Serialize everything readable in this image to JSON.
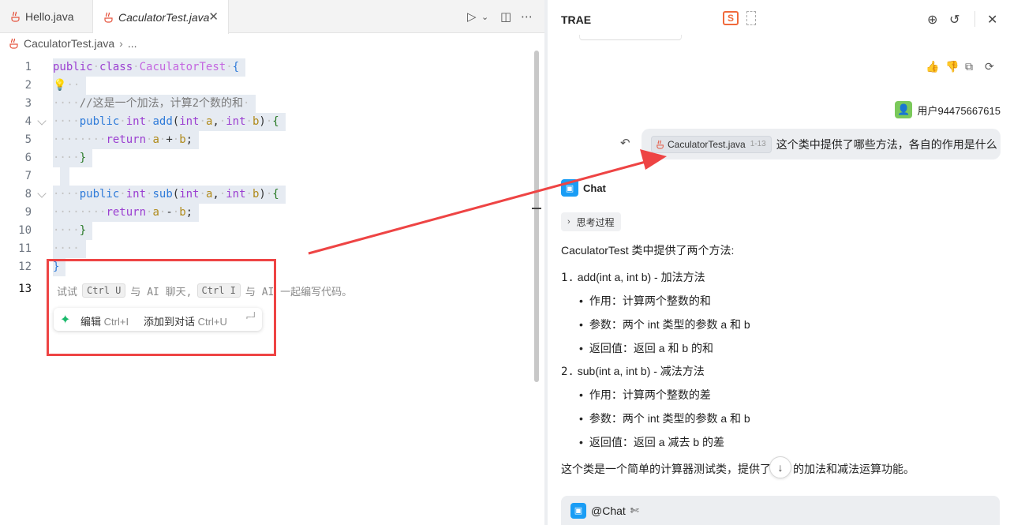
{
  "editor": {
    "tabs": [
      {
        "label": "Hello.java"
      },
      {
        "label": "CaculatorTest.java"
      }
    ],
    "breadcrumb": {
      "file": "CaculatorTest.java",
      "more": "..."
    },
    "line_numbers": [
      "1",
      "2",
      "3",
      "4",
      "5",
      "6",
      "7",
      "8",
      "9",
      "10",
      "11",
      "12",
      "13"
    ],
    "code": {
      "l1": {
        "kw1": "public",
        "kw2": "class",
        "cls": "CaculatorTest",
        "br": "{"
      },
      "l3": {
        "comment": "//这是一个加法，计算2个数的和"
      },
      "l4": {
        "kw": "public",
        "type": "int",
        "fn": "add",
        "open": "(",
        "t1": "int",
        "a": "a",
        "comma": ",",
        "t2": "int",
        "b": "b",
        "close": ")",
        "br": "{"
      },
      "l5": {
        "kw": "return",
        "a": "a",
        "op": "+",
        "b": "b",
        "semi": ";"
      },
      "l6": {
        "br": "}"
      },
      "l8": {
        "kw": "public",
        "type": "int",
        "fn": "sub",
        "open": "(",
        "t1": "int",
        "a": "a",
        "comma": ",",
        "t2": "int",
        "b": "b",
        "close": ")",
        "br": "{"
      },
      "l9": {
        "kw": "return",
        "a": "a",
        "op": "-",
        "b": "b",
        "semi": ";"
      },
      "l10": {
        "br": "}"
      },
      "l12": {
        "br": "}"
      }
    },
    "hint": {
      "pre": "试试",
      "key1": "Ctrl U",
      "mid1": "与 AI 聊天,",
      "key2": "Ctrl I",
      "mid2": "与 AI 一起编写代码。"
    },
    "float_bar": {
      "edit_label": "编辑",
      "edit_key": "Ctrl+I",
      "add_label": "添加到对话",
      "add_key": "Ctrl+U"
    }
  },
  "chat": {
    "title": "TRAE",
    "brand_glyph": "S",
    "user": {
      "name": "用户94475667615"
    },
    "user_message": {
      "file_chip": "CaculatorTest.java",
      "range": "1-13",
      "text": "这个类中提供了哪些方法，各自的作用是什么"
    },
    "bot": {
      "name": "Chat"
    },
    "thinking_label": "思考过程",
    "answer": {
      "intro": "CaculatorTest 类中提供了两个方法:",
      "m1": {
        "num": "1.",
        "title": "add(int a, int b) - 加法方法",
        "bullets": [
          "作用：计算两个整数的和",
          "参数：两个 int 类型的参数 a 和 b",
          "返回值：返回 a 和 b 的和"
        ]
      },
      "m2": {
        "num": "2.",
        "title": "sub(int a, int b) - 减法方法",
        "bullets": [
          "作用：计算两个整数的差",
          "参数：两个 int 类型的参数 a 和 b",
          "返回值：返回 a 减去 b 的差"
        ]
      },
      "summary_before": "这个类是一个简单的计算器测试类，提供了",
      "summary_after": "的加法和减法运算功能。"
    },
    "input": {
      "mention": "@Chat"
    }
  },
  "colors": {
    "accent_red": "#ee4444",
    "chat_avatar": "#1a9df5",
    "user_avatar": "#7bc95b",
    "spark": "#19b96b"
  }
}
